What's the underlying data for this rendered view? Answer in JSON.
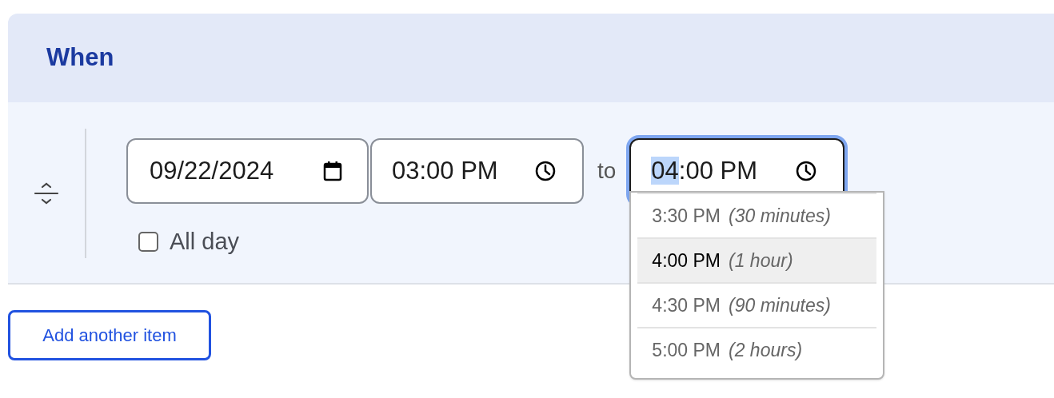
{
  "section": {
    "title": "When"
  },
  "date_field": {
    "value": "09/22/2024"
  },
  "start_time_field": {
    "value": "03:00 PM"
  },
  "separator": "to",
  "end_time_field": {
    "selected_part": "04",
    "rest": ":00 PM",
    "focused": true
  },
  "all_day": {
    "label": "All day",
    "checked": false
  },
  "end_time_options": [
    {
      "time": "3:30 PM",
      "duration": "(30 minutes)",
      "selected": false
    },
    {
      "time": "4:00 PM",
      "duration": "(1 hour)",
      "selected": true
    },
    {
      "time": "4:30 PM",
      "duration": "(90 minutes)",
      "selected": false
    },
    {
      "time": "5:00 PM",
      "duration": "(2 hours)",
      "selected": false
    }
  ],
  "add_button": "Add another item"
}
